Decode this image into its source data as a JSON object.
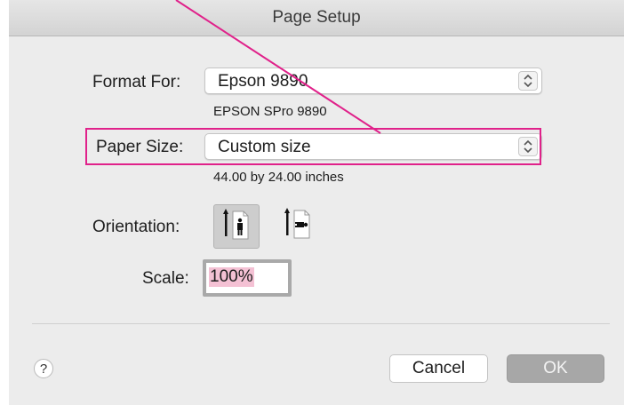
{
  "window": {
    "title": "Page Setup"
  },
  "format_for": {
    "label": "Format For:",
    "value": "Epson 9890",
    "description": "EPSON SPro 9890"
  },
  "paper_size": {
    "label": "Paper Size:",
    "value": "Custom size",
    "description": "44.00 by 24.00 inches"
  },
  "orientation": {
    "label": "Orientation:",
    "options": [
      {
        "name": "portrait",
        "icon": "portrait-orientation-icon",
        "selected": true
      },
      {
        "name": "landscape",
        "icon": "landscape-orientation-icon",
        "selected": false
      }
    ]
  },
  "scale": {
    "label": "Scale:",
    "value": "100%"
  },
  "buttons": {
    "help": "?",
    "cancel": "Cancel",
    "ok": "OK"
  },
  "colors": {
    "annotation": "#e0218a",
    "selection_highlight": "#f4c1d4",
    "ok_button": "#a7a7a7",
    "dialog_background": "#ececec"
  }
}
